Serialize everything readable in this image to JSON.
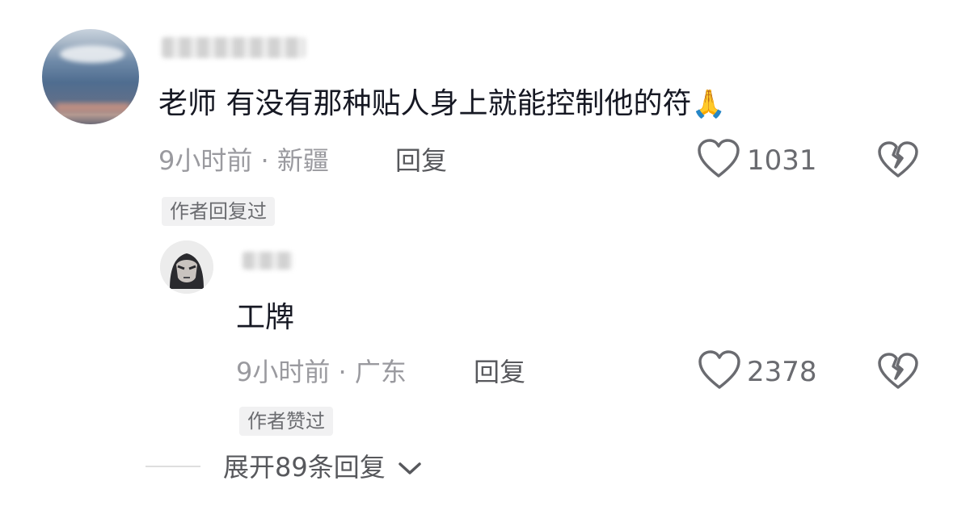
{
  "comments": [
    {
      "avatar": "landscape-avatar",
      "comment_text": "老师 有没有那种贴人身上就能控制他的符",
      "emoji": "🙏",
      "time_location": "9小时前 · 新疆",
      "reply_label": "回复",
      "like_icon": "heart-outline-icon",
      "like_count": "1031",
      "dislike_icon": "broken-heart-icon",
      "badge": "作者回复过",
      "reply": {
        "avatar": "cartoon-face-avatar",
        "comment_text": "工牌",
        "time_location": "9小时前 · 广东",
        "reply_label": "回复",
        "like_icon": "heart-outline-icon",
        "like_count": "2378",
        "dislike_icon": "broken-heart-icon",
        "badge": "作者赞过"
      },
      "expand_replies": "展开89条回复",
      "expand_icon": "chevron-down-icon"
    }
  ],
  "colors": {
    "primary_text": "#161823",
    "secondary_text": "#9a9a9f",
    "icon": "#6a6b70",
    "badge_bg": "#f1f1f2"
  }
}
